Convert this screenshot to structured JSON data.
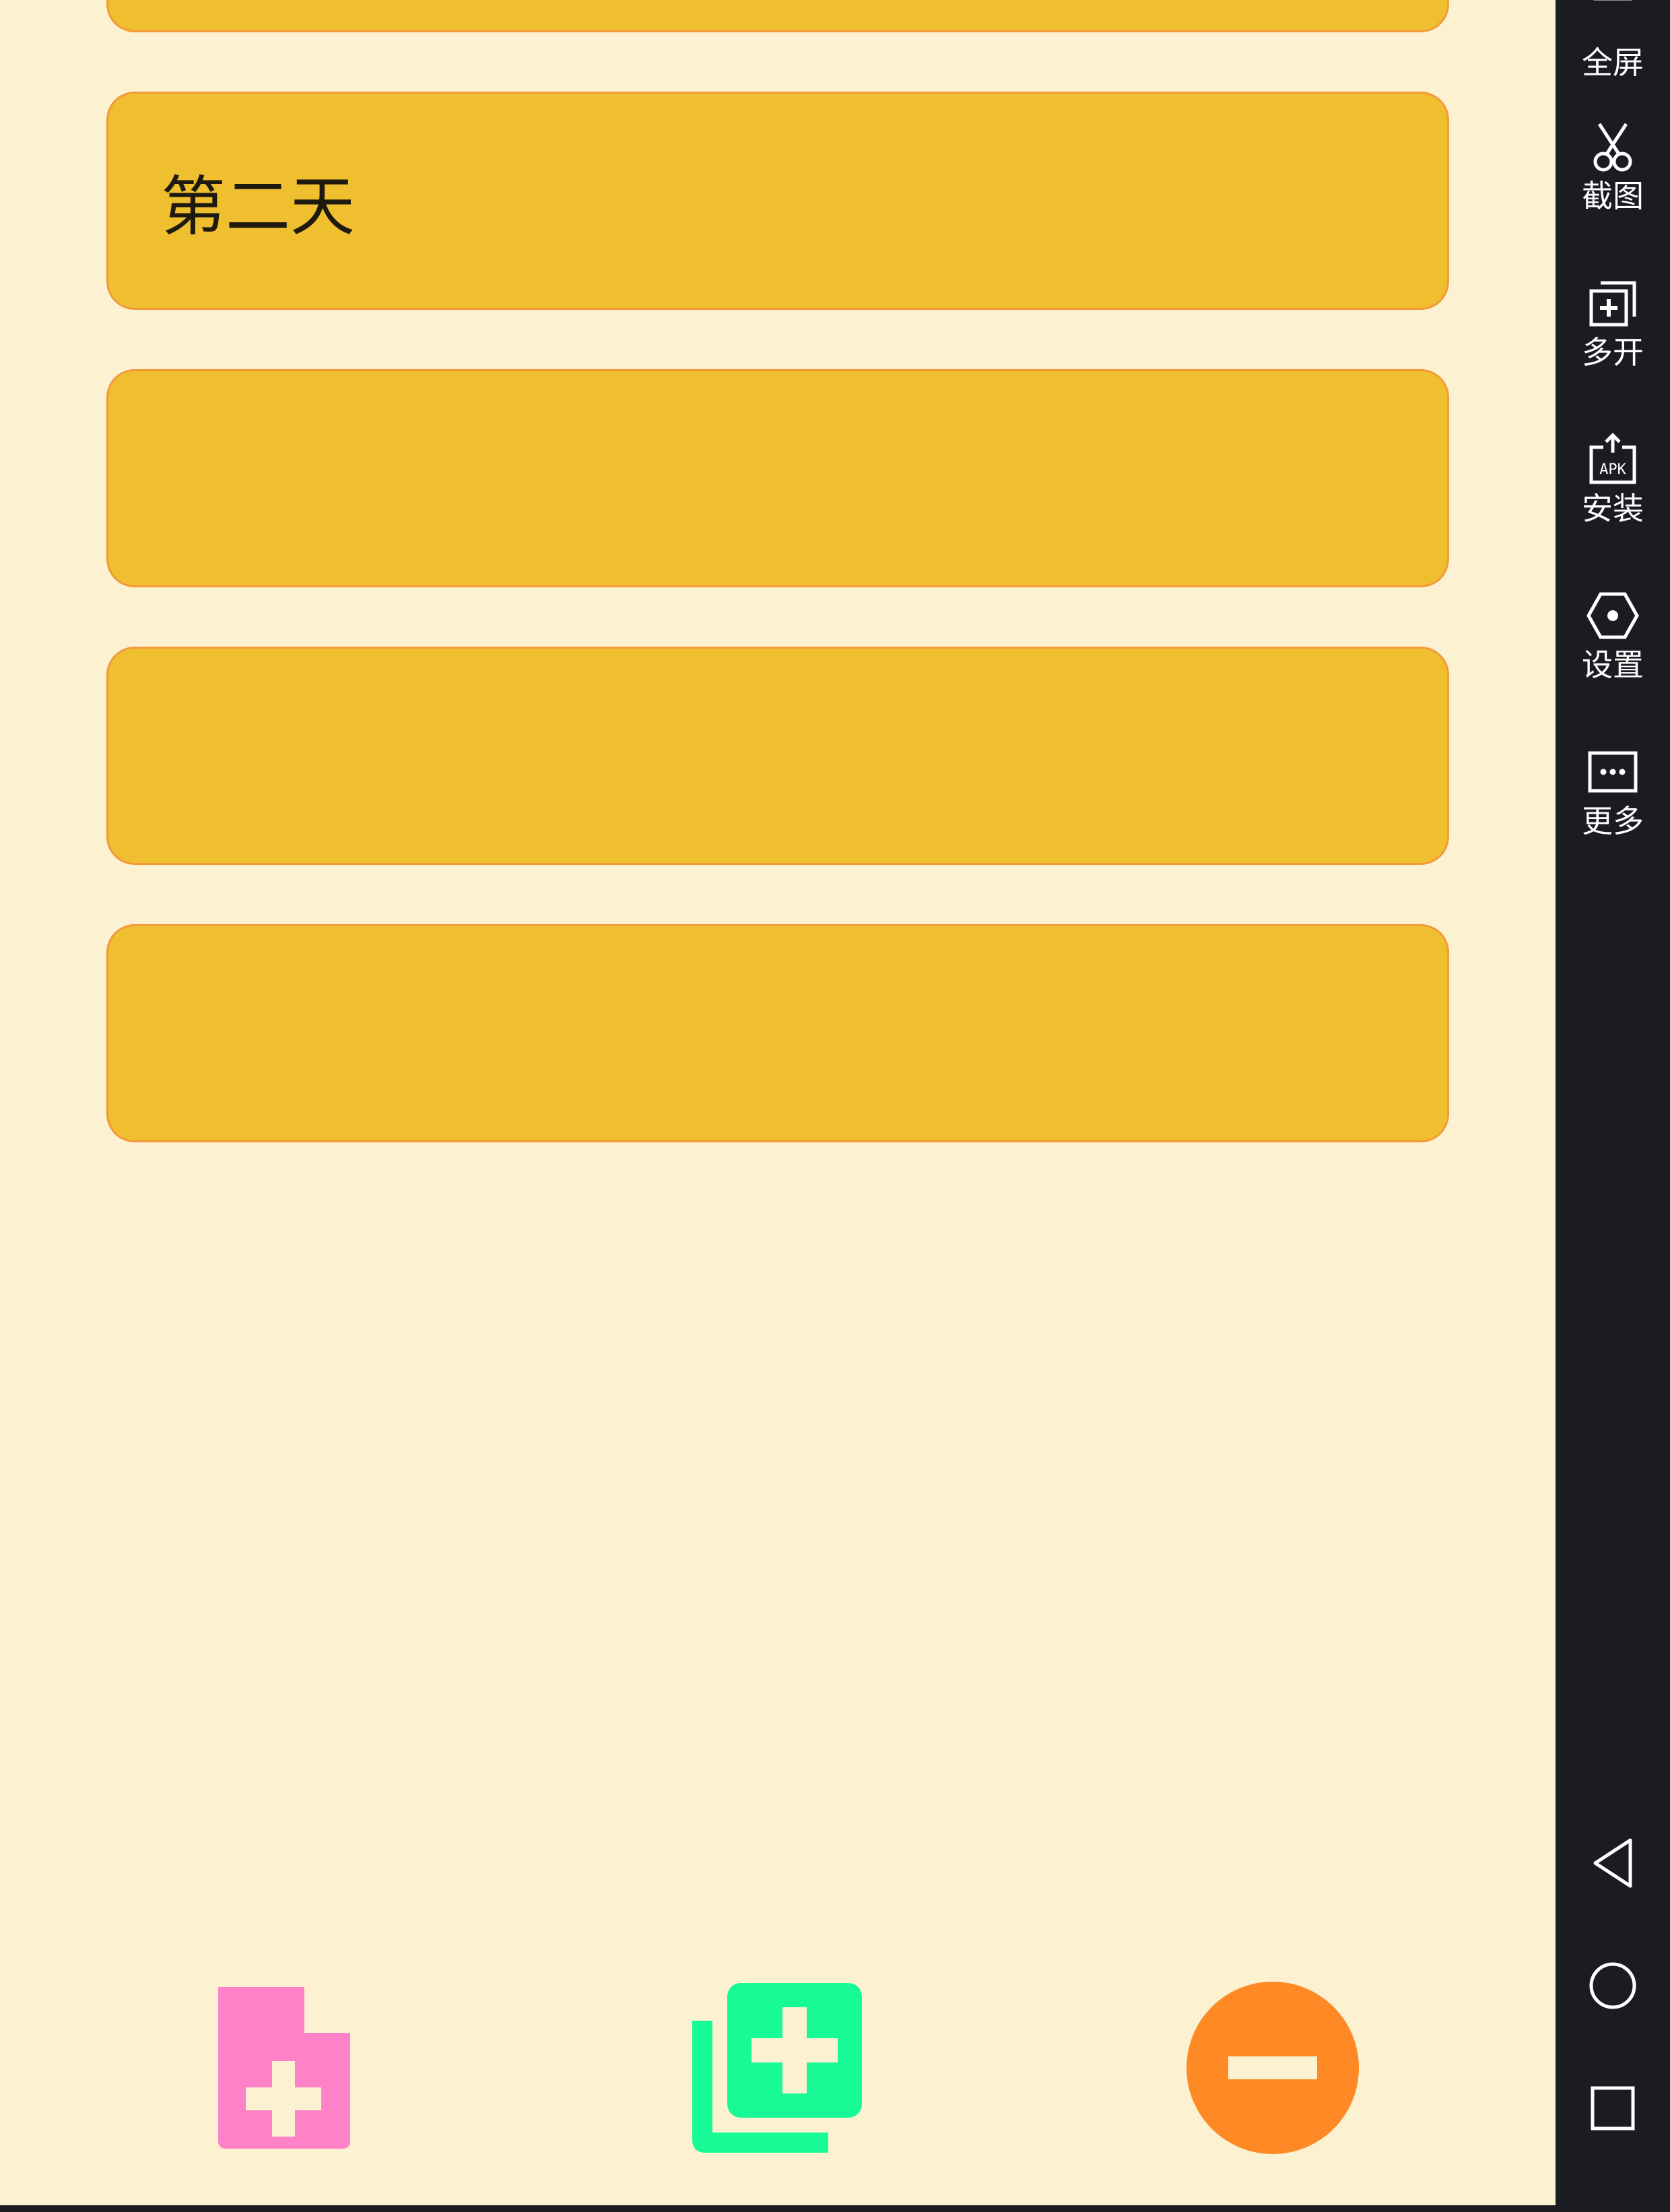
{
  "app": {
    "background": "#FCF2D2",
    "card_color": "#EFBF2F",
    "card_border": "#F29A3A",
    "cards": [
      {
        "label": ""
      },
      {
        "label": "第二天"
      },
      {
        "label": ""
      },
      {
        "label": ""
      },
      {
        "label": ""
      }
    ],
    "fabs": [
      {
        "icon": "note-add-icon",
        "color": "#FF82C8"
      },
      {
        "icon": "library-add-icon",
        "color": "#18FA96"
      },
      {
        "icon": "remove-circle-icon",
        "color": "#FF8A25"
      }
    ]
  },
  "sidebar": {
    "background": "#1B1B22",
    "items": [
      {
        "label": "全屏",
        "icon": "fullscreen-icon"
      },
      {
        "label": "截图",
        "icon": "scissors-icon"
      },
      {
        "label": "多开",
        "icon": "multi-instance-icon"
      },
      {
        "label": "安装",
        "icon": "apk-install-icon"
      },
      {
        "label": "设置",
        "icon": "settings-icon"
      },
      {
        "label": "更多",
        "icon": "more-icon"
      }
    ],
    "nav": [
      {
        "icon": "back-triangle-icon"
      },
      {
        "icon": "home-circle-icon"
      },
      {
        "icon": "recents-square-icon"
      }
    ]
  }
}
